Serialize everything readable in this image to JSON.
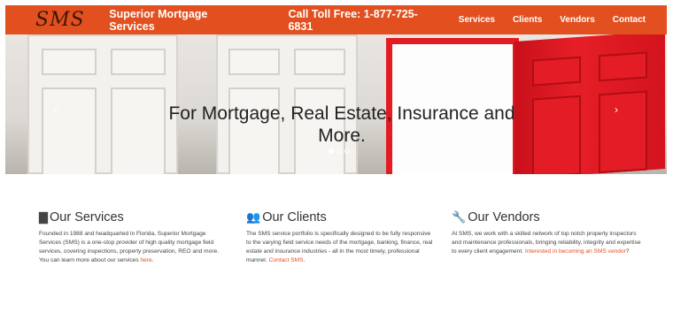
{
  "header": {
    "logo_text": "SMS",
    "brand": "Superior Mortgage Services",
    "phone": "Call Toll Free: 1-877-725-6831",
    "nav": [
      "Services",
      "Clients",
      "Vendors",
      "Contact"
    ]
  },
  "hero": {
    "title_line1": "For Mortgage, Real Estate, Insurance and",
    "title_line2": "More.",
    "prev_arrow": "‹",
    "next_arrow": "›"
  },
  "sections": {
    "services": {
      "heading": "Our Services",
      "text": "Founded in 1988 and headquarted in Florida, Superior Mortgage Services (SMS) is a one-stop provider of high quality mortgage field services, covering inspections, property preservation, REO and more. You can learn more about our services ",
      "link": "here",
      "after": "."
    },
    "clients": {
      "heading": "Our Clients",
      "text": "The SMS service portfolio is specifically designed to be fully responsive to the varying field service needs of the mortgage, banking, finance, real estate and insurance industries - all in the most timely, professional manner. ",
      "link": "Contact SMS",
      "after": "."
    },
    "vendors": {
      "heading": "Our Vendors",
      "text": "At SMS, we work with a skilled network of top notch property inspectors and maintenance professionals, bringing reliability, integrity and expertise to every client engagement. ",
      "link": "Interested in becoming an SMS vendor",
      "after": "?"
    }
  },
  "colors": {
    "accent": "#e2501f",
    "door_red": "#e31b23"
  }
}
